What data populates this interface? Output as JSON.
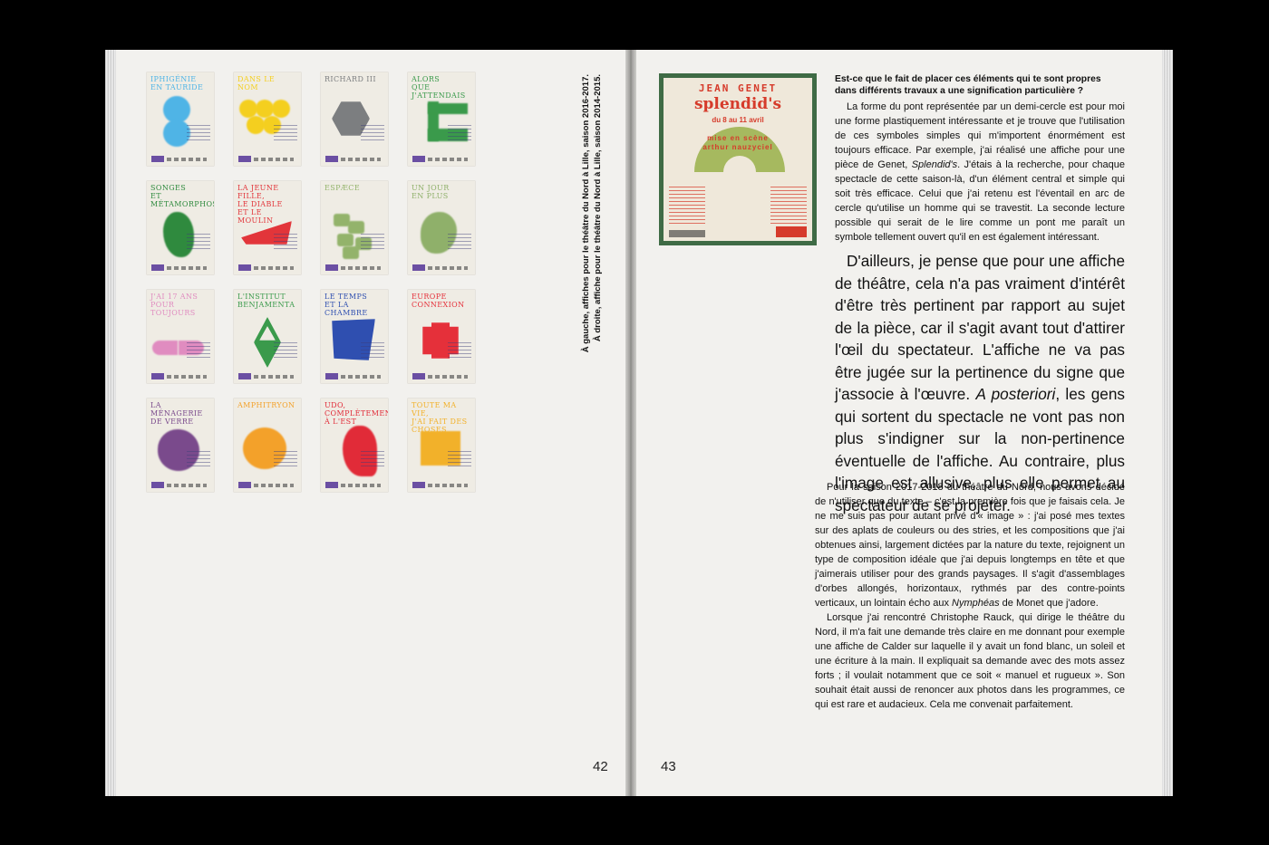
{
  "caption": {
    "line1": "À gauche, affiches pour le théâtre du Nord à Lille, saison 2016-2017.",
    "line2": "À droite, affiche pour le théâtre du Nord à Lille, saison 2014-2015."
  },
  "posters": [
    {
      "title": "Iphigénie\nen Tauride",
      "color": "#4fb4e6"
    },
    {
      "title": "Dans le nom",
      "color": "#f4cf1f"
    },
    {
      "title": "Richard III",
      "color": "#7c7e80"
    },
    {
      "title": "Alors\nque j'attendais",
      "color": "#3a9a4b"
    },
    {
      "title": "Songes\net métamorphoses",
      "color": "#2f8a3e"
    },
    {
      "title": "La jeune fille,\nle diable\net le moulin",
      "color": "#e2353a"
    },
    {
      "title": "Espæce",
      "color": "#93b36b"
    },
    {
      "title": "Un jour\nen plus",
      "color": "#8fb06a"
    },
    {
      "title": "J'ai 17 ans\npour toujours",
      "color": "#e08cc0"
    },
    {
      "title": "L'institut\nBenjamenta",
      "color": "#3a9a4b"
    },
    {
      "title": "Le temps\net la chambre",
      "color": "#2f4fb0"
    },
    {
      "title": "Europe\nconnexion",
      "color": "#e5303a"
    },
    {
      "title": "La ménagerie\nde verre",
      "color": "#7a4a8c"
    },
    {
      "title": "Amphitryon",
      "color": "#f3a12a"
    },
    {
      "title": "Udo,\ncomplètement à l'est",
      "color": "#e12b38"
    },
    {
      "title": "Toute ma vie,\nj'ai fait des choses",
      "color": "#f2b12a"
    }
  ],
  "folios": {
    "left": "42",
    "right": "43"
  },
  "genet_poster": {
    "author": "JEAN GENET",
    "play": "splendid's",
    "dates": "du 8 au 11 avril",
    "mise": "mise en scène\narthur nauzyciel"
  },
  "question": "Est-ce que le fait de placer ces éléments qui te sont propres dans différents travaux a une signification particulière ?",
  "para1": {
    "before": "La forme du pont représentée par un demi-cercle est pour moi une forme plastiquement intéressante et je trouve que l'utilisation de ces symboles simples qui m'importent énormément est toujours efficace. Par exemple, j'ai réalisé une affiche pour une pièce de Genet, ",
    "italic": "Splendid's",
    "after": ". J'étais à la recherche, pour chaque spectacle de cette saison-là, d'un élément central et simple qui soit très efficace. Celui que j'ai retenu est l'éventail en arc de cercle qu'utilise un homme qui se travestit. La seconde lecture possible qui serait de le lire comme un pont me paraît un symbole tellement ouvert qu'il en est également intéressant."
  },
  "lead": {
    "before": "D'ailleurs, je pense que pour une affiche de théâtre, cela n'a pas vraiment d'intérêt d'être très pertinent par rapport au sujet de la pièce, car il s'agit avant tout d'attirer l'œil du spectateur. L'affiche ne va pas être jugée sur la pertinence du signe que j'associe à l'œuvre. ",
    "italic": "A posteriori",
    "after": ", les gens qui sortent du spectacle ne vont pas non plus s'indigner sur la non-pertinence éventuelle de l'affiche. Au contraire, plus l'image est allusive, plus elle permet au spectateur de se projeter."
  },
  "body2": {
    "p1_before": "Pour la saison 2017-2018 du théâtre du Nord, nous avons décidé de n'utiliser que du texte – c'est la première fois que je faisais cela. Je ne me suis pas pour autant privé d'« image » : j'ai posé mes textes sur des aplats de couleurs ou des stries, et les compositions que j'ai obtenues ainsi, largement dictées par la nature du texte, rejoignent un type de composition idéale que j'ai depuis longtemps en tête et que j'aimerais utiliser pour des grands paysages. Il s'agit d'assemblages d'orbes allongés, horizontaux, rythmés par des contre-points verticaux, un lointain écho aux ",
    "p1_italic": "Nymphéas",
    "p1_after": " de Monet que j'adore.",
    "p2": "Lorsque j'ai rencontré Christophe Rauck, qui dirige le théâtre du Nord, il m'a fait une demande très claire en me donnant pour exemple une affiche de Calder sur laquelle il y avait un fond blanc, un soleil et une écriture à la main. Il expliquait sa demande avec des mots assez forts ; il voulait notamment que ce soit « manuel et rugueux ». Son souhait était aussi de renoncer aux photos dans les programmes, ce qui est rare et audacieux. Cela me convenait parfaitement."
  }
}
